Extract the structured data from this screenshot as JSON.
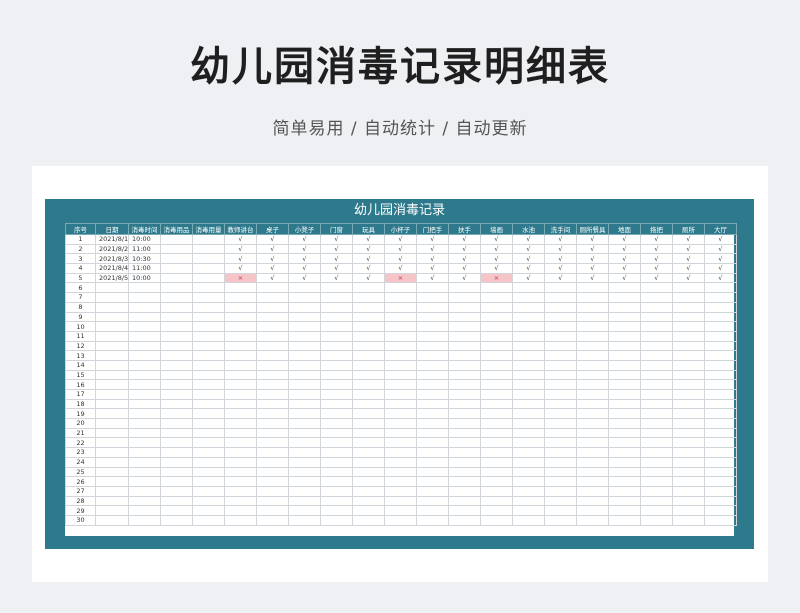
{
  "page_title": "幼儿园消毒记录明细表",
  "subtitle": "简单易用 / 自动统计 / 自动更新",
  "sheet": {
    "title": "幼儿园消毒记录",
    "headers": [
      "序号",
      "日期",
      "消毒时间",
      "消毒用品",
      "消毒用量",
      "教师讲台",
      "桌子",
      "小凳子",
      "门窗",
      "玩具",
      "小杯子",
      "门把手",
      "扶手",
      "墙画",
      "水池",
      "洗手间",
      "厕所餐具",
      "地面",
      "拖把",
      "厕所",
      "大厅"
    ],
    "widths": [
      30,
      33,
      32,
      32,
      32,
      32,
      32,
      32,
      32,
      32,
      32,
      32,
      32,
      32,
      32,
      32,
      32,
      32,
      32,
      32,
      32
    ],
    "check_symbol": "√",
    "cross_symbol": "×",
    "rows": [
      {
        "no": "1",
        "date": "2021/8/1",
        "time": "10:00",
        "marks": [
          "√",
          "√",
          "√",
          "√",
          "√",
          "√",
          "√",
          "√",
          "√",
          "√",
          "√",
          "√",
          "√",
          "√",
          "√",
          "√"
        ]
      },
      {
        "no": "2",
        "date": "2021/8/2",
        "time": "11:00",
        "marks": [
          "√",
          "√",
          "√",
          "√",
          "√",
          "√",
          "√",
          "√",
          "√",
          "√",
          "√",
          "√",
          "√",
          "√",
          "√",
          "√"
        ]
      },
      {
        "no": "3",
        "date": "2021/8/3",
        "time": "10:30",
        "marks": [
          "√",
          "√",
          "√",
          "√",
          "√",
          "√",
          "√",
          "√",
          "√",
          "√",
          "√",
          "√",
          "√",
          "√",
          "√",
          "√"
        ]
      },
      {
        "no": "4",
        "date": "2021/8/4",
        "time": "11:00",
        "marks": [
          "√",
          "√",
          "√",
          "√",
          "√",
          "√",
          "√",
          "√",
          "√",
          "√",
          "√",
          "√",
          "√",
          "√",
          "√",
          "√"
        ]
      },
      {
        "no": "5",
        "date": "2021/8/5",
        "time": "10:00",
        "marks": [
          "×",
          "√",
          "√",
          "√",
          "√",
          "×",
          "√",
          "√",
          "×",
          "√",
          "√",
          "√",
          "√",
          "√",
          "√",
          "√"
        ]
      }
    ],
    "empty_row_numbers": [
      "6",
      "7",
      "8",
      "9",
      "10",
      "11",
      "12",
      "13",
      "14",
      "15",
      "16",
      "17",
      "18",
      "19",
      "20",
      "21",
      "22",
      "23",
      "24",
      "25",
      "26",
      "27",
      "28",
      "29",
      "30"
    ]
  }
}
